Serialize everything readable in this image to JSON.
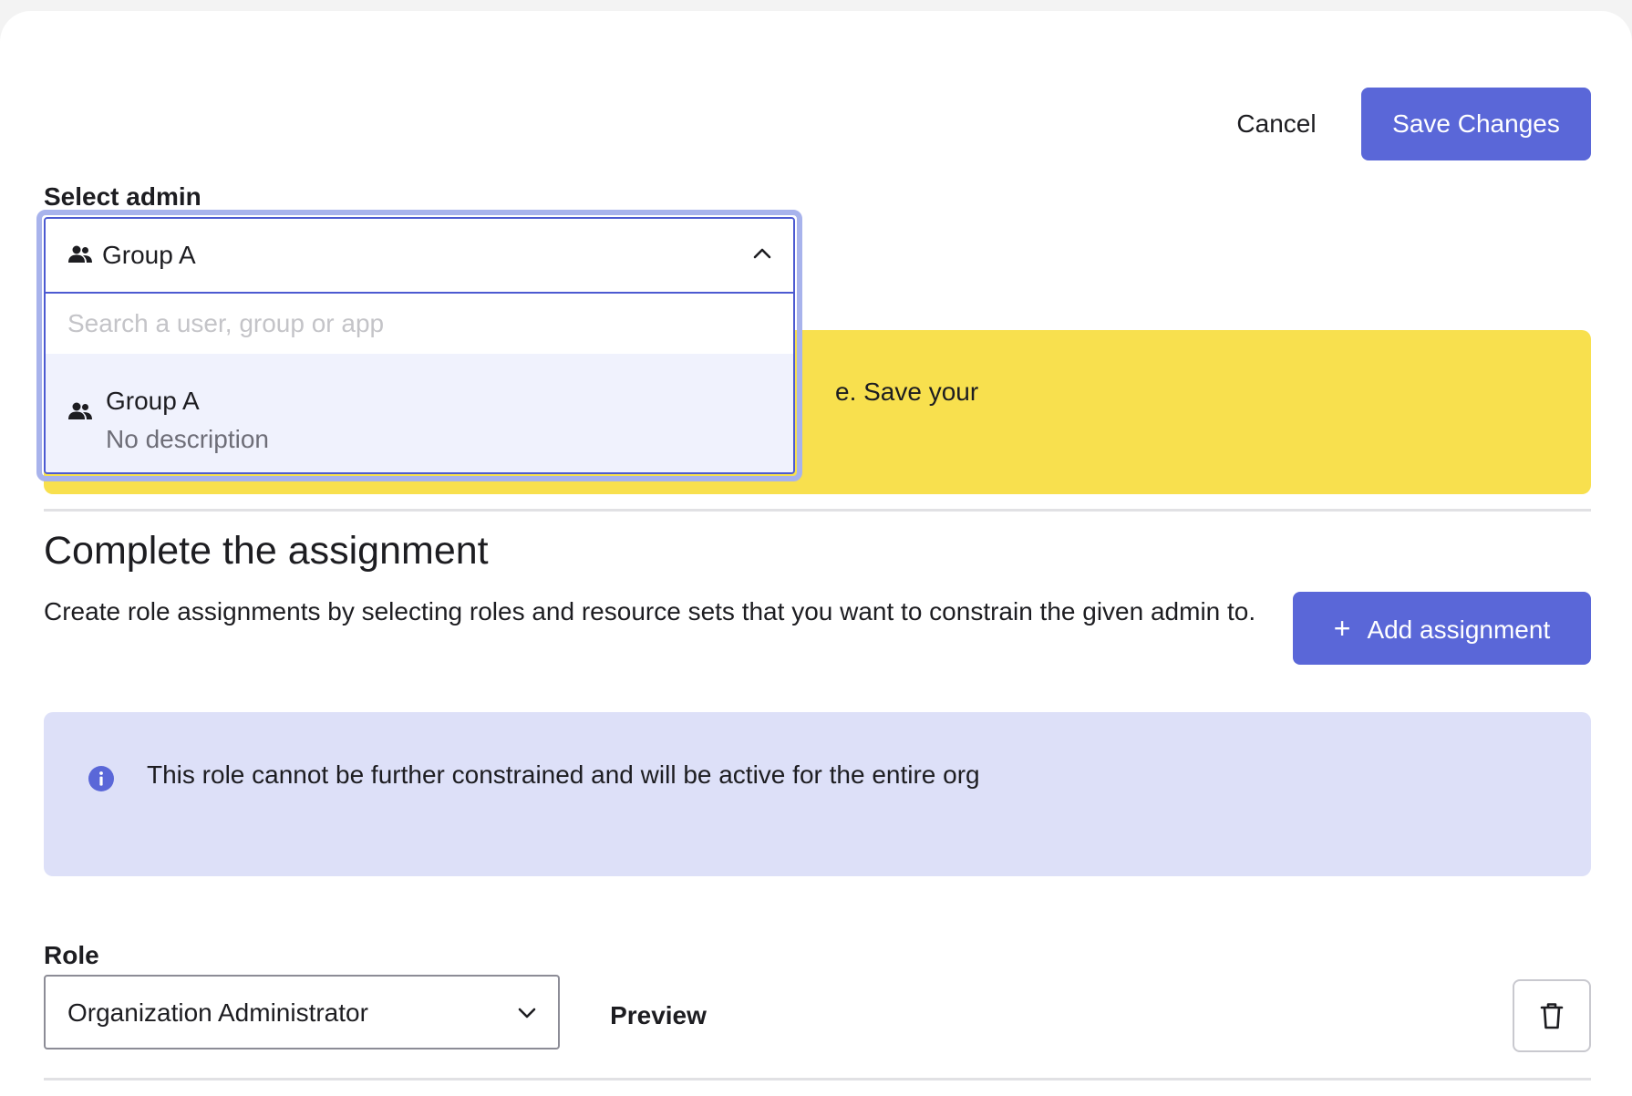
{
  "header": {
    "cancel_label": "Cancel",
    "save_label": "Save Changes"
  },
  "admin_select": {
    "label": "Select admin",
    "selected_value": "Group A",
    "selected_icon": "group-icon",
    "expanded": true,
    "search_placeholder": "Search a user, group or app",
    "options": [
      {
        "title": "Group A",
        "description": "No description",
        "icon": "group-icon"
      }
    ]
  },
  "warning": {
    "visible_text": "e. Save your",
    "color": "#f8e04e"
  },
  "assignment": {
    "title": "Complete the assignment",
    "description": "Create role assignments by selecting roles and resource sets that you want to constrain the given admin to.",
    "add_label": "Add assignment",
    "add_icon": "plus-icon",
    "info_icon": "info-icon",
    "info_text": "This role cannot be further constrained and will be active for the entire org",
    "role_label": "Role",
    "role_value": "Organization Administrator",
    "preview_label": "Preview",
    "delete_icon": "trash-icon"
  },
  "colors": {
    "accent": "#5a67d8",
    "info_background": "#dde0f8",
    "focus_ring": "#a8b3ec"
  }
}
